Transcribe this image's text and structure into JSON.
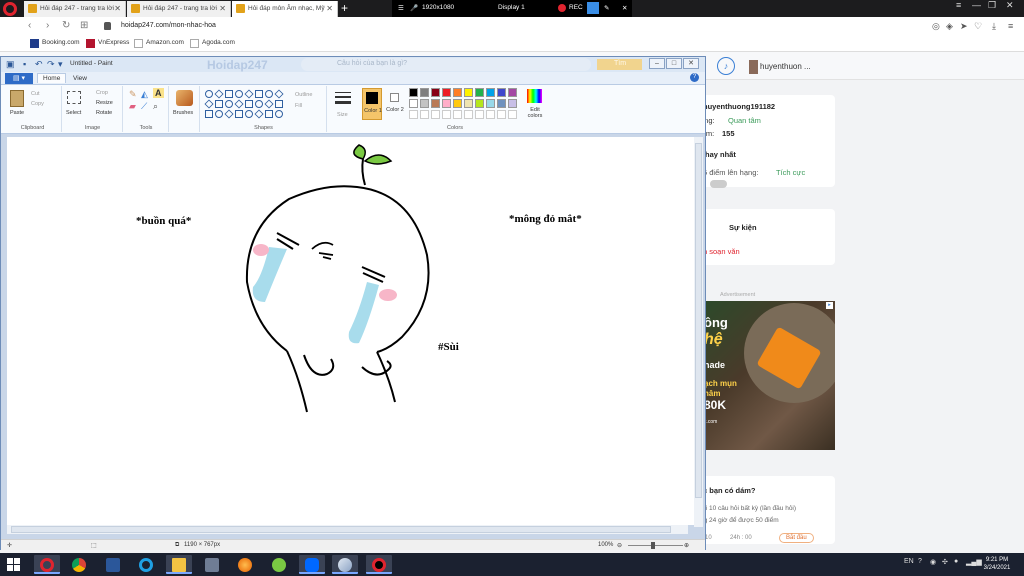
{
  "browser": {
    "tabs": [
      {
        "title": "Hỏi đáp 247 - trang tra lời",
        "active": false
      },
      {
        "title": "Hỏi đáp 247 - trang tra lời",
        "active": false
      },
      {
        "title": "Hỏi đáp môn Âm nhạc, Mỹ",
        "active": true
      }
    ],
    "url": "hoidap247.com/mon-nhac-hoa",
    "bookmarks": [
      "Booking.com",
      "VnExpress",
      "Amazon.com",
      "Agoda.com"
    ]
  },
  "recorder": {
    "resolution": "1920x1080",
    "display": "Display 1",
    "rec_label": "REC"
  },
  "site": {
    "header_user": "huyenthuon ...",
    "profile": {
      "username": "huyenthuong191182",
      "follow_prefix": "ông:",
      "follow_label": "Quan tâm",
      "points_prefix": "iểm:",
      "points": "155"
    },
    "best": {
      "title": "hay nhất",
      "rank_text": "5 điểm lên hạng:",
      "rank_badge": "Tích cực"
    },
    "events": {
      "title": "Sự kiện",
      "item": "n soạn văn"
    },
    "ad": {
      "label": "Advertisement",
      "lines": [
        "ông",
        "hệ",
        "nade",
        "ạch mụn",
        "hâm",
        "80K",
        "k.com"
      ]
    },
    "challenge": {
      "title": "c bạn có dám?",
      "line1": "lời 10 câu hỏi  bất kỳ (lần đầu hỏi)",
      "line2": "ng 24 giờ để được 50 điểm",
      "progress": "0/10",
      "timer": "24h : 00",
      "button": "Bắt đầu"
    }
  },
  "paint": {
    "title": "Untitled - Paint",
    "site_watermark": "Hoidap247",
    "ghost_search": "Câu hỏi của bạn là gì?",
    "ghost_button": "Tìm",
    "file_button": "▤ ▾",
    "tabs": [
      "Home",
      "View"
    ],
    "groups": {
      "clipboard": {
        "label": "Clipboard",
        "paste": "Paste",
        "cut": "Cut",
        "copy": "Copy"
      },
      "image": {
        "label": "Image",
        "select": "Select",
        "crop": "Crop",
        "resize": "Resize",
        "rotate": "Rotate"
      },
      "tools": {
        "label": "Tools"
      },
      "brushes": {
        "label": "Brushes"
      },
      "shapes": {
        "label": "Shapes",
        "outline": "Outline",
        "fill": "Fill"
      },
      "size": {
        "label": "Size"
      },
      "colors": {
        "label": "Colors",
        "color1": "Color 1",
        "color2": "Color 2",
        "edit": "Edit colors"
      }
    },
    "palette_row1": [
      "#000000",
      "#7f7f7f",
      "#880015",
      "#ed1c24",
      "#ff7f27",
      "#fff200",
      "#22b14c",
      "#00a2e8",
      "#3f48cc",
      "#a349a4"
    ],
    "palette_row2": [
      "#ffffff",
      "#c3c3c3",
      "#b97a57",
      "#ffaec9",
      "#ffc90e",
      "#efe4b0",
      "#b5e61d",
      "#99d9ea",
      "#7092be",
      "#c8bfe7"
    ],
    "canvas_texts": {
      "left": "*buồn quá*",
      "right": "*mông đỏ mắt*",
      "tag": "#Sùi"
    },
    "status": {
      "dimensions": "1190 × 767px",
      "zoom": "100%"
    }
  },
  "taskbar": {
    "clock_time": "9:21 PM",
    "clock_date": "3/24/2021",
    "tray_lang": "EN"
  },
  "colors": {
    "accent": "#2e6bc7",
    "rec": "#e0242f",
    "tear": "#a8dcec",
    "blush": "#f7b6c8",
    "sprout": "#7ac943"
  }
}
